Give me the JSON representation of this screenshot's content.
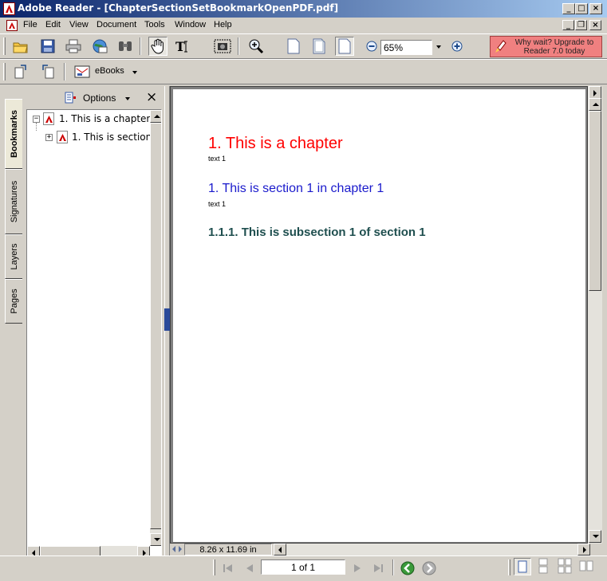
{
  "window": {
    "title": "Adobe Reader - [ChapterSectionSetBookmarkOpenPDF.pdf]"
  },
  "menu": [
    "File",
    "Edit",
    "View",
    "Document",
    "Tools",
    "Window",
    "Help"
  ],
  "toolbar": {
    "zoom_value": "65%",
    "ebooks_label": "eBooks",
    "upgrade_text": "Why wait? Upgrade to Reader 7.0 today"
  },
  "navigation_tabs": [
    "Bookmarks",
    "Signatures",
    "Layers",
    "Pages"
  ],
  "bookmarks_panel": {
    "options_label": "Options",
    "close_glyph": "×",
    "items": [
      {
        "expander": "−",
        "label": "1. This is a chapter"
      },
      {
        "expander": "+",
        "label": "1. This is section"
      }
    ]
  },
  "document": {
    "chapter_heading": "1. This is a chapter",
    "chapter_text": "text 1",
    "section_heading": "1. This is section 1 in chapter 1",
    "section_text": "text 1",
    "subsection_heading": "1.1.1. This is subsection 1 of section 1",
    "page_size": "8.26 x 11.69 in"
  },
  "status": {
    "page_indicator": "1 of 1"
  },
  "colors": {
    "chapter": "#ff0000",
    "section": "#1a1acc",
    "subsection": "#1f4f4f",
    "titlebar_start": "#0a246a",
    "upgrade_bg": "#f08080"
  }
}
